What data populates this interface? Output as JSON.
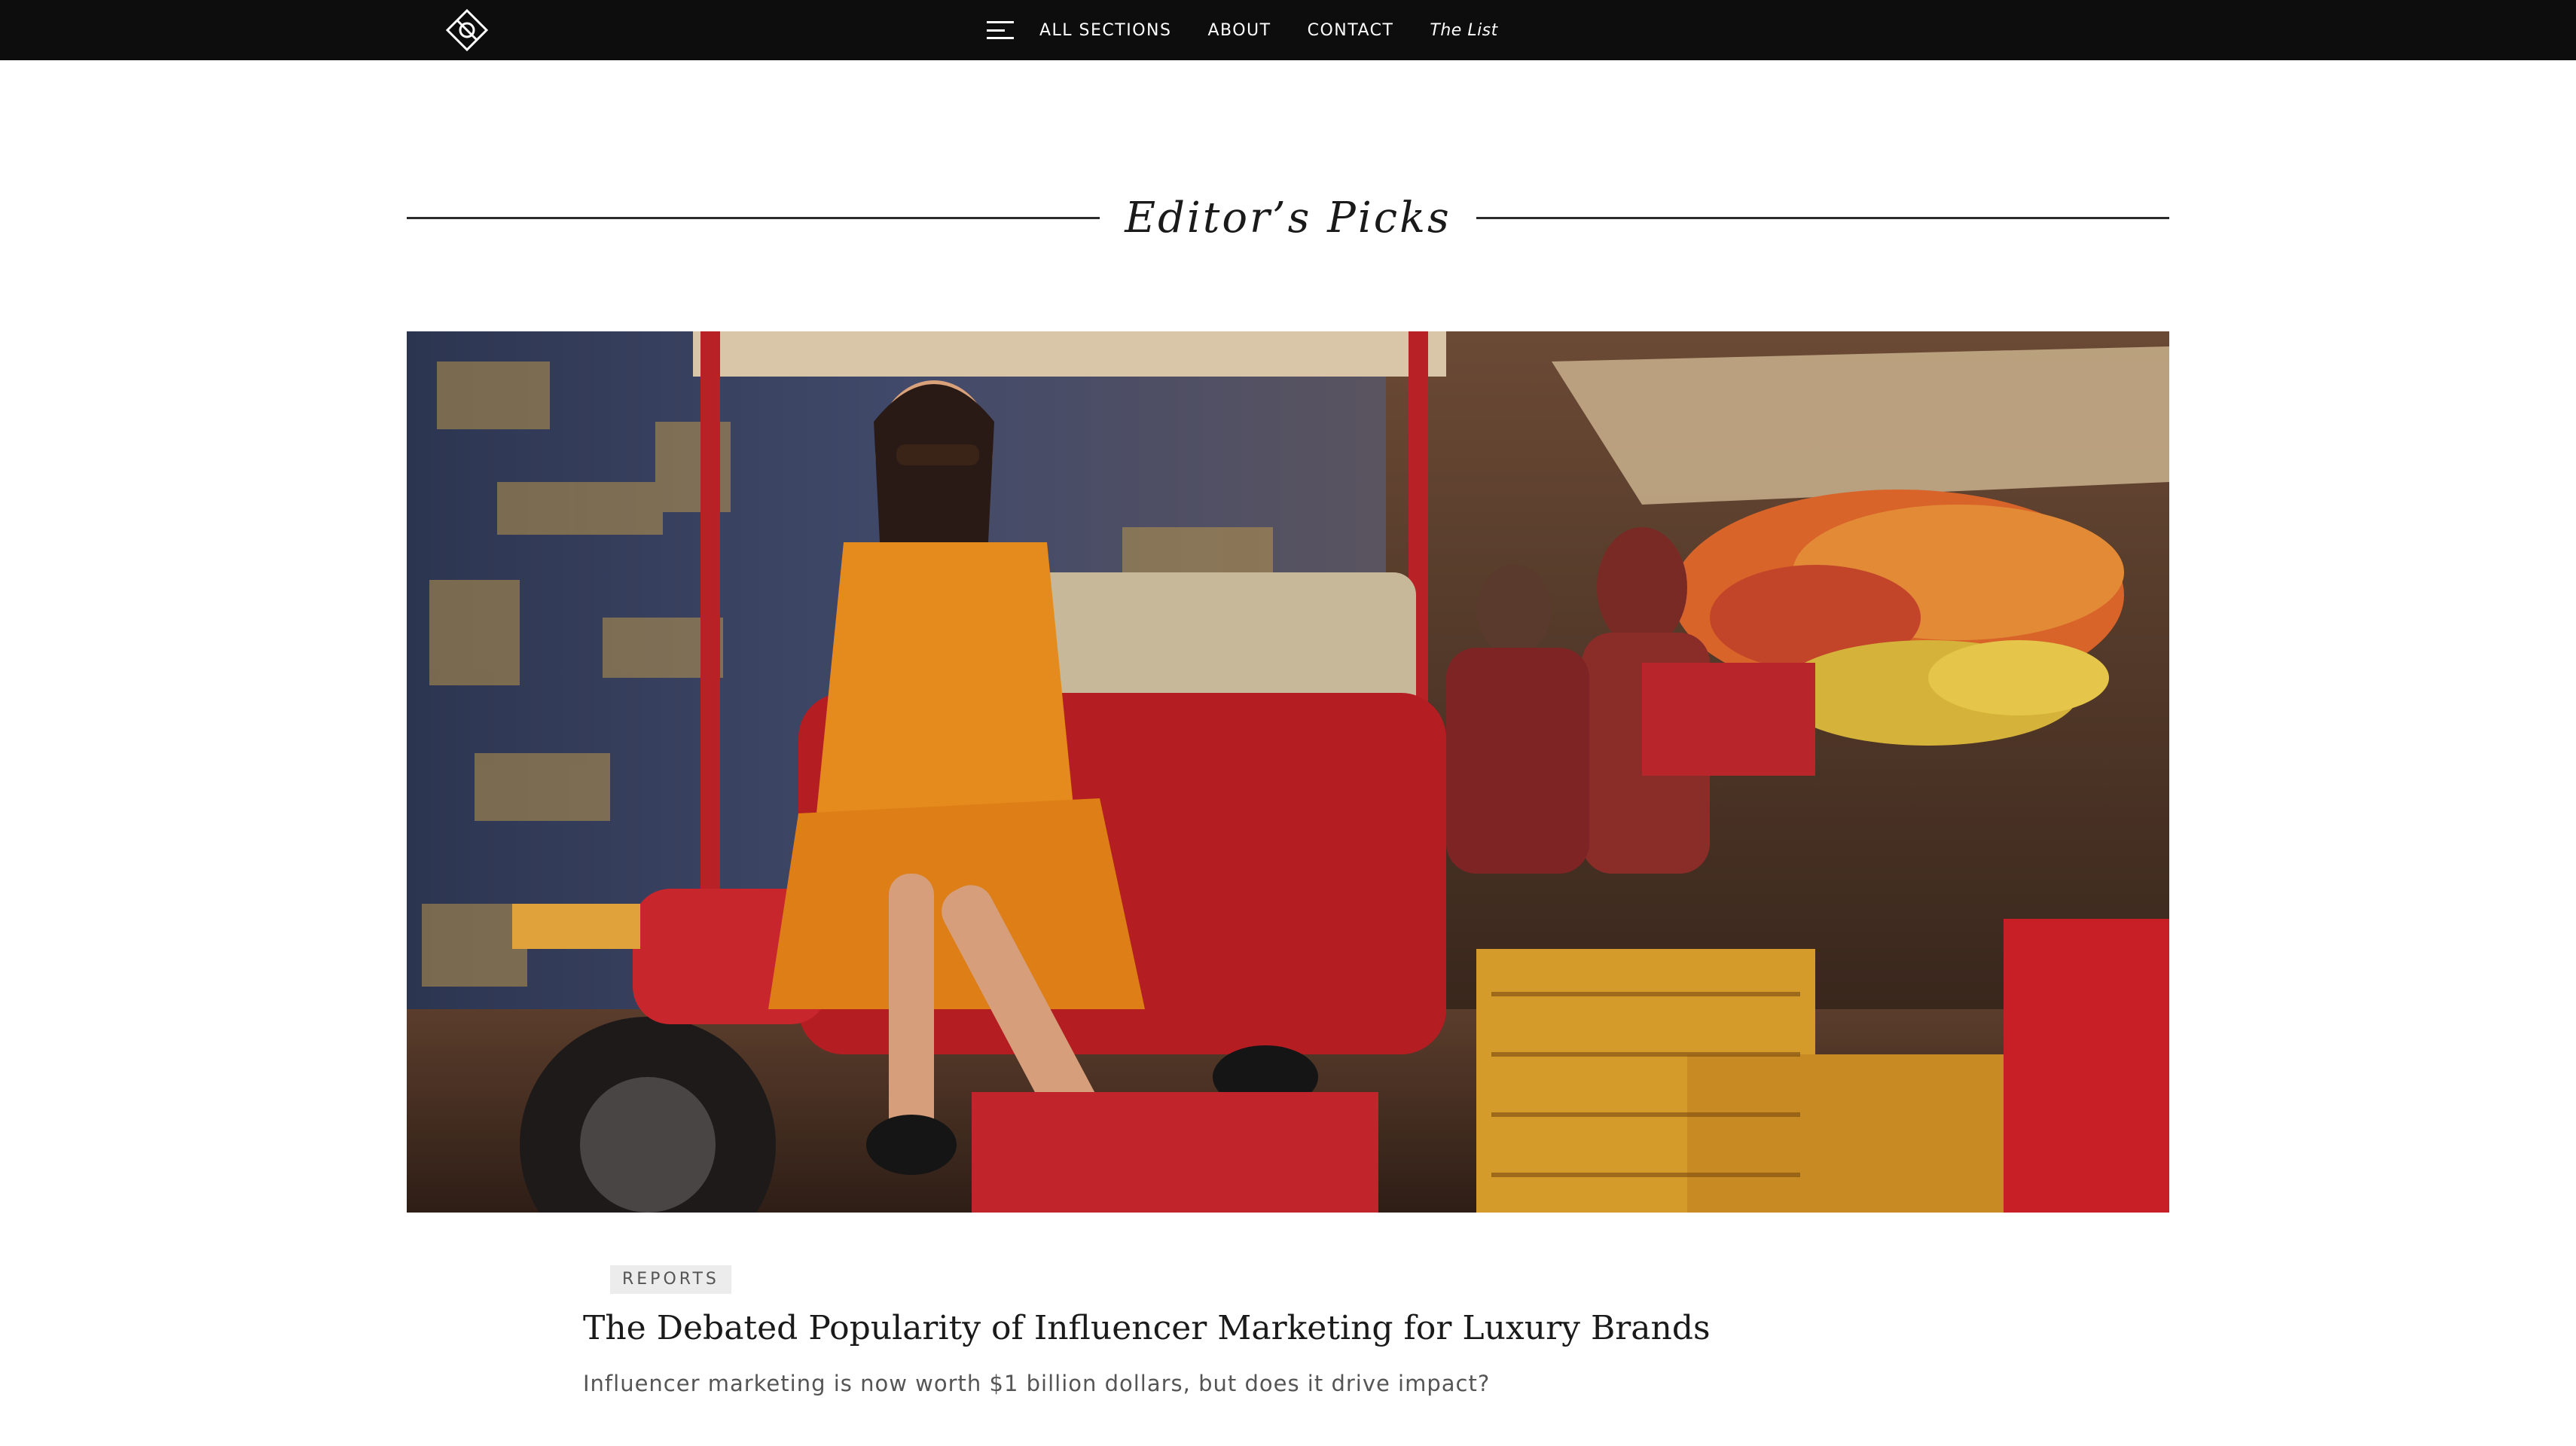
{
  "nav": {
    "logo": "diamond-logo",
    "menu_icon": "hamburger-menu-icon",
    "links": [
      "ALL SECTIONS",
      "ABOUT",
      "CONTACT"
    ],
    "list_link": "The List"
  },
  "section": {
    "title": "Editor’s Picks"
  },
  "feature": {
    "image": "hero-photo",
    "category": "REPORTS",
    "headline": "The Debated Popularity of Influencer Marketing for Luxury Brands",
    "dek": "Influencer marketing is now worth $1 billion dollars, but does it drive impact?"
  },
  "colors": {
    "nav_background": "#0d0d0d",
    "nav_text": "#ffffff",
    "tag_background": "#ececec",
    "body_text": "#1a1a1a",
    "muted_text": "#555555"
  }
}
